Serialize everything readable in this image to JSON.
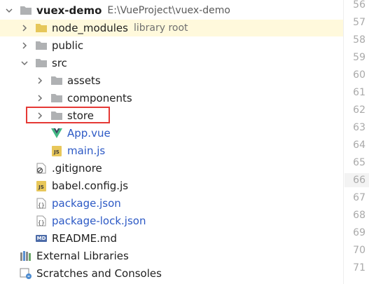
{
  "tree": {
    "root": {
      "name": "vuex-demo",
      "path": "E:\\VueProject\\vuex-demo"
    },
    "node_modules": {
      "name": "node_modules",
      "hint": "library root"
    },
    "public": {
      "name": "public"
    },
    "src": {
      "name": "src"
    },
    "assets": {
      "name": "assets"
    },
    "components": {
      "name": "components"
    },
    "store": {
      "name": "store"
    },
    "app_vue": {
      "name": "App.vue"
    },
    "main_js": {
      "name": "main.js",
      "badge": "JS"
    },
    "gitignore": {
      "name": ".gitignore"
    },
    "babel_config": {
      "name": "babel.config.js",
      "badge": "JS"
    },
    "package_json": {
      "name": "package.json"
    },
    "package_lock": {
      "name": "package-lock.json"
    },
    "readme": {
      "name": "README.md",
      "badge": "MD"
    },
    "external_libraries": {
      "name": "External Libraries"
    },
    "scratches": {
      "name": "Scratches and Consoles"
    }
  },
  "gutter": {
    "line_numbers": [
      "56",
      "57",
      "58",
      "59",
      "60",
      "61",
      "62",
      "63",
      "64",
      "65",
      "66",
      "67",
      "68",
      "69",
      "70",
      "71"
    ],
    "highlighted_line": "66"
  },
  "colors": {
    "folder": "#afb1b3",
    "folder_yellow": "#e6c75a",
    "vue_green": "#41b883",
    "vue_dark": "#35495e",
    "link_blue": "#2c59c5",
    "highlight_box": "#e53935"
  }
}
